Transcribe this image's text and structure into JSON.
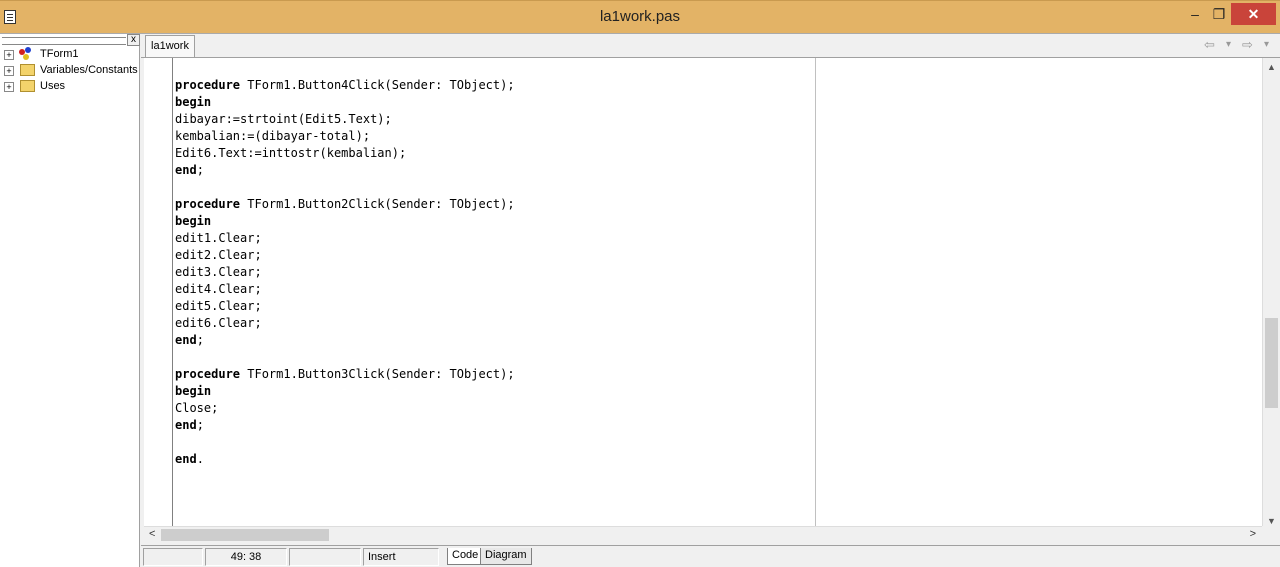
{
  "window": {
    "title": "la1work.pas",
    "minimize_glyph": "–",
    "restore_glyph": "❐",
    "close_glyph": "✕"
  },
  "tree": {
    "close_glyph": "x",
    "items": [
      {
        "label": "TForm1",
        "icon": "component-icon",
        "expand_glyph": "+"
      },
      {
        "label": "Variables/Constants",
        "icon": "folder-icon",
        "expand_glyph": "+"
      },
      {
        "label": "Uses",
        "icon": "folder-icon",
        "expand_glyph": "+"
      }
    ]
  },
  "tabs": {
    "active": "la1work",
    "nav_back": "⇦",
    "nav_back_dd": "▾",
    "nav_fwd": "⇨",
    "nav_fwd_dd": "▾"
  },
  "code_lines": [
    {
      "kw": "procedure",
      "rest": " TForm1.Button4Click(Sender: TObject);"
    },
    {
      "kw": "begin",
      "rest": ""
    },
    {
      "kw": "",
      "rest": "dibayar:=strtoint(Edit5.Text);"
    },
    {
      "kw": "",
      "rest": "kembalian:=(dibayar-total);"
    },
    {
      "kw": "",
      "rest": "Edit6.Text:=inttostr(kembalian);"
    },
    {
      "kw": "end",
      "rest": ";"
    },
    {
      "kw": "",
      "rest": ""
    },
    {
      "kw": "procedure",
      "rest": " TForm1.Button2Click(Sender: TObject);"
    },
    {
      "kw": "begin",
      "rest": ""
    },
    {
      "kw": "",
      "rest": "edit1.Clear;"
    },
    {
      "kw": "",
      "rest": "edit2.Clear;"
    },
    {
      "kw": "",
      "rest": "edit3.Clear;"
    },
    {
      "kw": "",
      "rest": "edit4.Clear;"
    },
    {
      "kw": "",
      "rest": "edit5.Clear;"
    },
    {
      "kw": "",
      "rest": "edit6.Clear;"
    },
    {
      "kw": "end",
      "rest": ";"
    },
    {
      "kw": "",
      "rest": ""
    },
    {
      "kw": "procedure",
      "rest": " TForm1.Button3Click(Sender: TObject);"
    },
    {
      "kw": "begin",
      "rest": ""
    },
    {
      "kw": "",
      "rest": "Close;"
    },
    {
      "kw": "end",
      "rest": ";"
    },
    {
      "kw": "",
      "rest": ""
    },
    {
      "kw": "end",
      "rest": "."
    }
  ],
  "scroll": {
    "up": "▲",
    "down": "▼",
    "left": "<",
    "right": ">"
  },
  "status": {
    "position": "49:  38",
    "mode": "Insert",
    "views": [
      "Code",
      "Diagram"
    ]
  }
}
